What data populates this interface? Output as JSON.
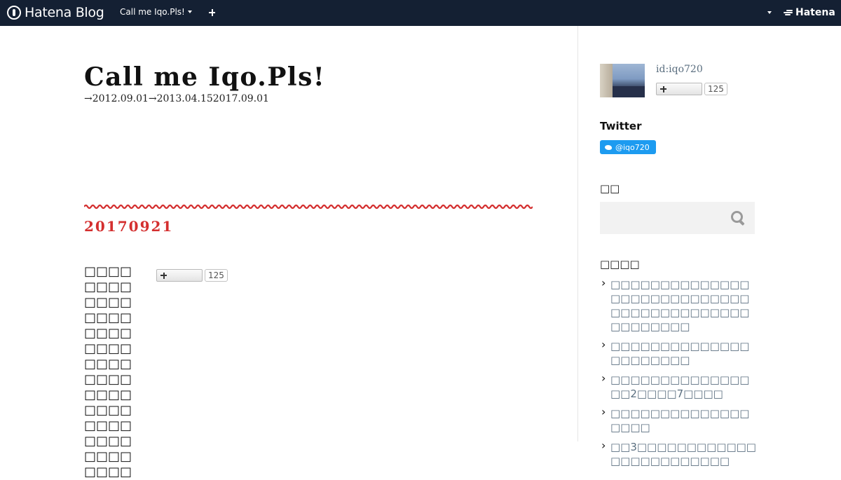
{
  "topbar": {
    "logo": "Hatena Blog",
    "blog_menu_label": "Call me Iqo.Pls!",
    "add_icon": "plus-icon",
    "brand": "Hatena"
  },
  "blog": {
    "title": "Call me Iqo.Pls!",
    "description": "→2012.09.01→2013.04.152017.09.01"
  },
  "entry": {
    "date_title": "20170921",
    "body": "□□□□□□□□□□□□□□□□□□□□□□□□□□□□□□□□□□□□□□□□□□□□□□□□□□□□□□□□",
    "bookmark_count": "125"
  },
  "sidebar": {
    "profile": {
      "id": "id:iqo720",
      "bookmark_count": "125"
    },
    "twitter": {
      "heading": "Twitter",
      "follow_label": "@iqo720"
    },
    "search": {
      "heading": "□□",
      "placeholder": ""
    },
    "recent": {
      "heading": "□□□□",
      "items": [
        "□□□□□□□□□□□□□□□□□□□□□□□□□□□□□□□□□□□□□□□□□□□□□□□□□□",
        "□□□□□□□□□□□□□□□□□□□□□□",
        "□□□□□□□□□□□□□□□□2□□□□7□□□□",
        "□□□□□□□□□□□□□□□□□□",
        "□□3□□□□□□□□□□□□□□□□□□□□□□□□"
      ]
    }
  },
  "colors": {
    "topbar_bg": "#142033",
    "accent_red": "#d42f2f",
    "link": "#5a6e7f",
    "twitter_blue": "#1d9bf0"
  }
}
